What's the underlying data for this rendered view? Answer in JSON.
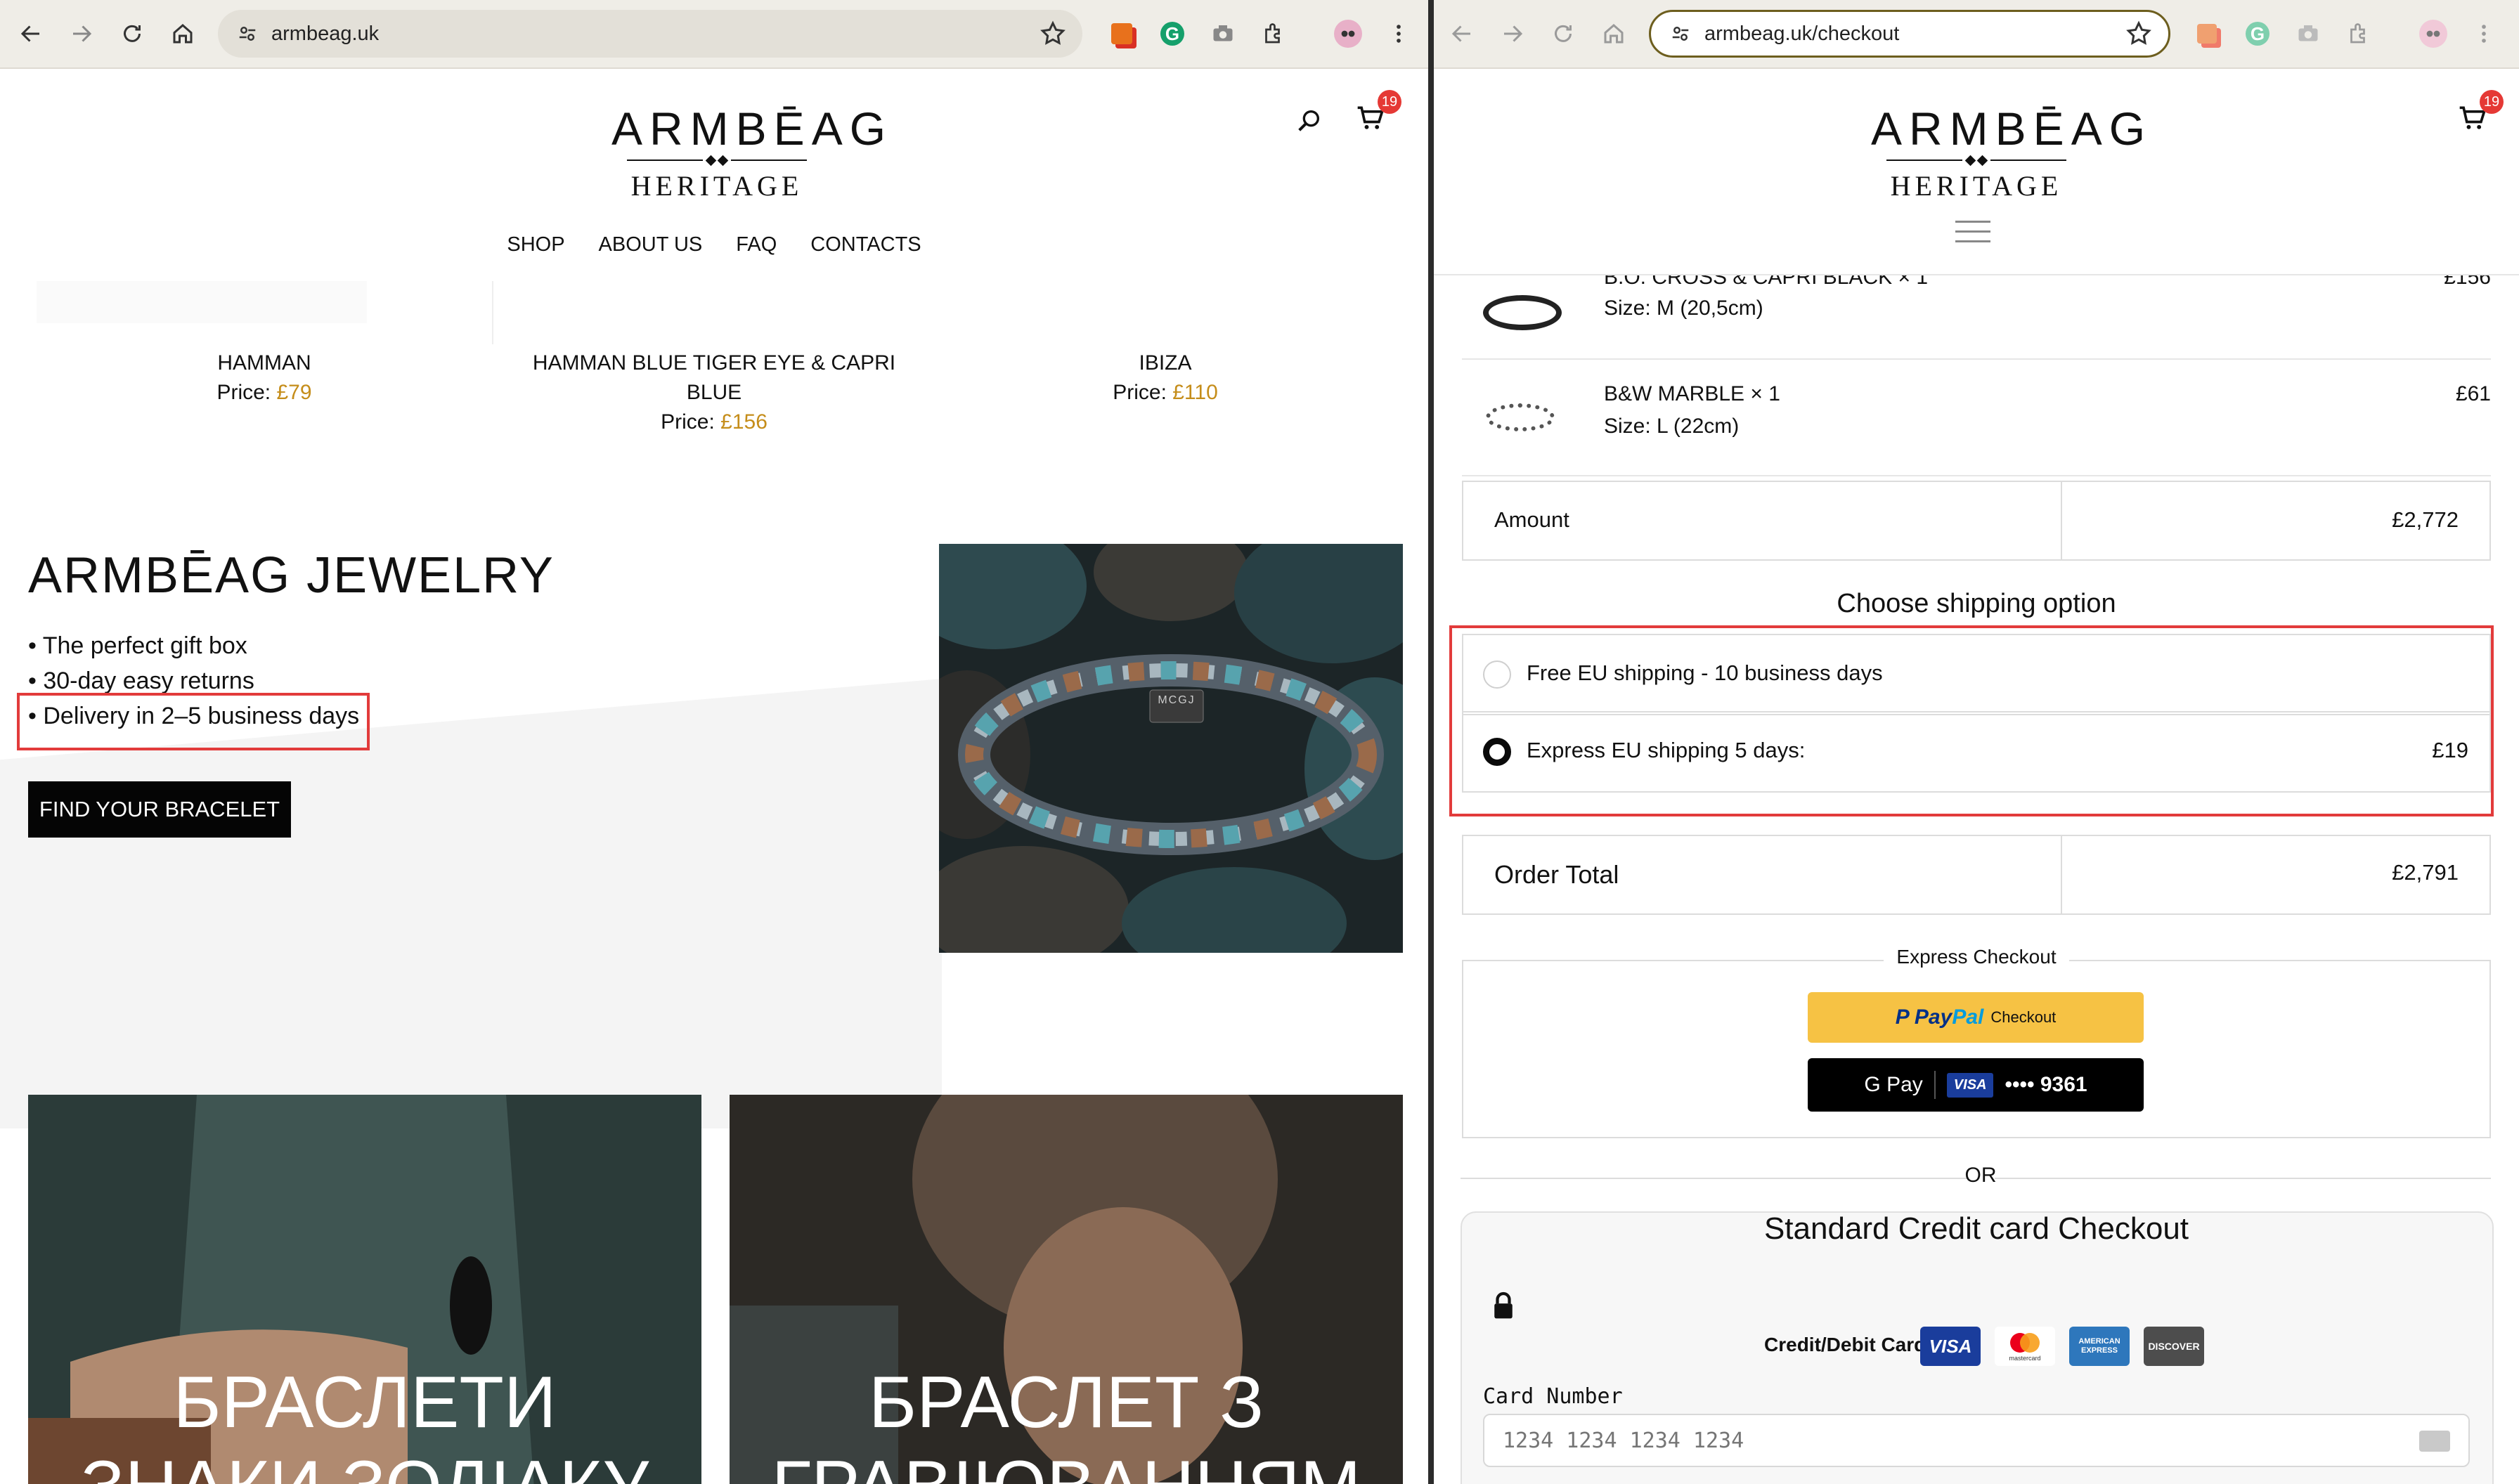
{
  "left_browser": {
    "url": "armbeag.uk"
  },
  "right_browser": {
    "url": "armbeag.uk/checkout"
  },
  "logo": {
    "line1": "ARMBĒAG",
    "line2": "HERITAGE"
  },
  "cart_count": "19",
  "nav": [
    "SHOP",
    "ABOUT US",
    "FAQ",
    "CONTACTS"
  ],
  "products": [
    {
      "name": "HAMMAN",
      "price_label": "Price:",
      "price": "£79"
    },
    {
      "name": "HAMMAN BLUE TIGER EYE & CAPRI BLUE",
      "price_label": "Price:",
      "price": "£156"
    },
    {
      "name": "IBIZA",
      "price_label": "Price:",
      "price": "£110"
    }
  ],
  "hero": {
    "title": "ARMBĒAG JEWELRY",
    "bullets": [
      "• The perfect gift box",
      "• 30-day easy returns",
      "• Delivery in 2–5 business days"
    ],
    "button": "FIND YOUR BRACELET",
    "badge": "MCGJ"
  },
  "tiles": [
    {
      "text_line1": "БРАСЛЕТИ",
      "text_line2": "ЗНАКИ ЗОДІАКУ"
    },
    {
      "text_line1": "БРАСЛЕТ З",
      "text_line2": "ГРАВІЮВАННЯМ"
    }
  ],
  "checkout": {
    "items": [
      {
        "name": "B.O. CROSS & CAPRI BLACK",
        "qty": "× 1",
        "size": "Size: M (20,5cm)",
        "price": "£156"
      },
      {
        "name": "B&W MARBLE",
        "qty": "× 1",
        "size": "Size: L (22cm)",
        "price": "£61"
      }
    ],
    "amount_label": "Amount",
    "amount_value": "£2,772",
    "shipping_title": "Choose shipping option",
    "shipping_options": [
      {
        "label": "Free EU shipping - 10 business days",
        "price": "",
        "selected": false
      },
      {
        "label": "Express EU shipping 5 days:",
        "price": "£19",
        "selected": true
      }
    ],
    "order_total_label": "Order Total",
    "order_total_value": "£2,791",
    "express_checkout_label": "Express Checkout",
    "paypal": {
      "brand1": "Pay",
      "brand2": "Pal",
      "suffix": "Checkout"
    },
    "gpay": {
      "label": "G Pay",
      "card_brand": "VISA",
      "card_digits": "•••• 9361"
    },
    "or_label": "OR",
    "standard_title": "Standard Credit card Checkout",
    "cards_label": "Credit/Debit Cards",
    "card_logos": [
      "VISA",
      "mastercard",
      "AMERICAN EXPRESS",
      "DISCOVER"
    ],
    "card_number_label": "Card Number",
    "card_number_placeholder": "1234 1234 1234 1234"
  },
  "colors": {
    "price_accent": "#c58d1a",
    "highlight": "#e23b3b",
    "paypal_yellow": "#f6c244"
  }
}
